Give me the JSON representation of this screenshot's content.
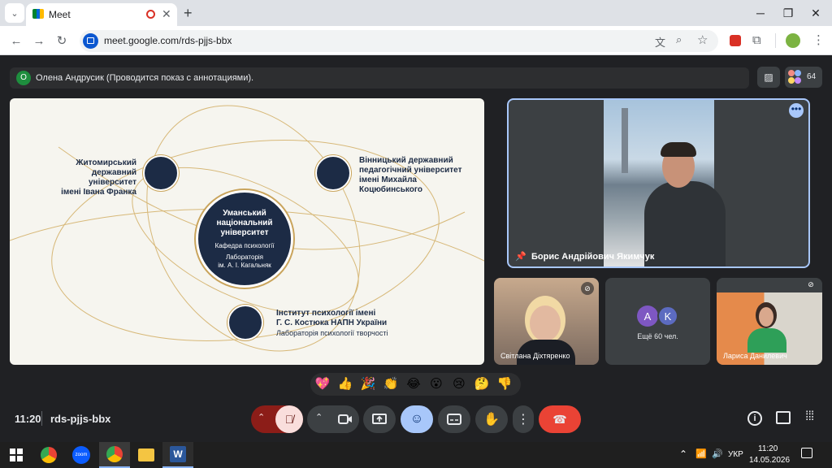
{
  "browser": {
    "tab_title": "Meet",
    "new_tab": "+",
    "url": "meet.google.com/rds-pjjs-bbx"
  },
  "meet": {
    "presenter_badge": "О",
    "presenter_text": "Олена Андрусик (Проводится показ с аннотациями).",
    "participant_count": "64",
    "slide": {
      "left_top": "Житомирський\nдержавний університет\nімені Івана Франка",
      "right_top": "Вінницький державний\nпедагогічний університет\nімені Михайла\nКоцюбинського",
      "center_title": "Уманський\nнаціональний\nуніверситет",
      "center_dept": "Кафедра психології",
      "center_lab": "Лабораторія\nім. А. І. Кагальняк",
      "bottom_title": "Інститут психології імені\nГ. С. Костюка НАПН України",
      "bottom_lab": "Лабораторія психології творчості"
    },
    "speaker_name": "Борис Андрійович Якимчук",
    "tiles": [
      {
        "name": "Світлана Діхтяренко"
      },
      {
        "name": "Ещё 60 чел.",
        "avatars": [
          "A",
          "K"
        ]
      },
      {
        "name": "Лариса Данилевич"
      }
    ],
    "reactions": [
      "💖",
      "👍",
      "🎉",
      "👏",
      "😂",
      "😮",
      "😢",
      "🤔",
      "👎"
    ],
    "time": "11:20",
    "meeting_code": "rds-pjjs-bbx"
  },
  "taskbar": {
    "lang": "УКР",
    "time": "11:20",
    "date": "14.05.2026"
  },
  "colors": {
    "accent_blue": "#a8c7fa",
    "end_call": "#ea4335",
    "mic_off": "#f9dedc",
    "slide_navy": "#1c2b45",
    "slide_gold": "#c9a45c"
  }
}
